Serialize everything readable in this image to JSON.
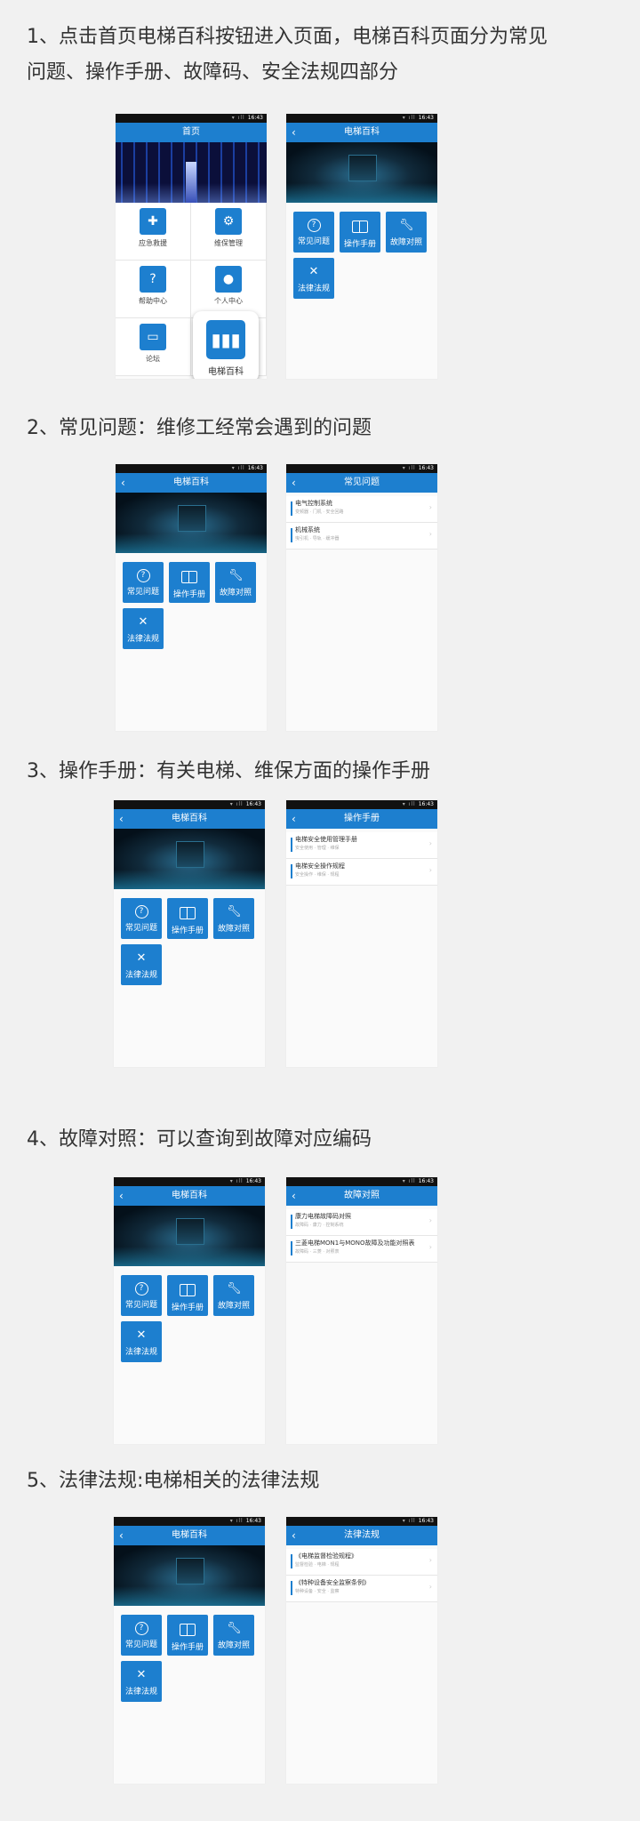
{
  "sections": [
    {
      "title_line1": "1、点击首页电梯百科按钮进入页面，电梯百科页面分为常见",
      "title_line2": "问题、操作手册、故障码、安全法规四部分"
    },
    {
      "title": "2、常见问题：维修工经常会遇到的问题"
    },
    {
      "title": "3、操作手册：有关电梯、维保方面的操作手册"
    },
    {
      "title": "4、故障对照：可以查询到故障对应编码"
    },
    {
      "title": "5、法律法规:电梯相关的法律法规"
    }
  ],
  "status": {
    "time": "16:43",
    "signal": "▾ ıll"
  },
  "home": {
    "title": "首页",
    "cells": [
      "应急救援",
      "维保管理",
      "帮助中心",
      "个人中心",
      "论坛",
      ""
    ],
    "popup_label": "电梯百科"
  },
  "wiki": {
    "title": "电梯百科",
    "back": "‹",
    "tiles": [
      "常见问题",
      "操作手册",
      "故障对照",
      "法律法规"
    ]
  },
  "faq": {
    "title": "常见问题",
    "items": [
      {
        "title": "电气控制系统",
        "sub": "变频器 · 门机 · 安全回路"
      },
      {
        "title": "机械系统",
        "sub": "曳引机 · 导轨 · 缓冲器"
      }
    ]
  },
  "manual": {
    "title": "操作手册",
    "items": [
      {
        "title": "电梯安全使用管理手册",
        "sub": "安全使用 · 管理 · 维保"
      },
      {
        "title": "电梯安全操作规程",
        "sub": "安全操作 · 维保 · 规程"
      }
    ]
  },
  "fault": {
    "title": "故障对照",
    "items": [
      {
        "title": "康力电梯故障码对照",
        "sub": "故障码 · 康力 · 控制系统"
      },
      {
        "title": "三菱电梯MON1与MONO故障及功能对照表",
        "sub": "故障码 · 三菱 · 对照表"
      }
    ]
  },
  "law": {
    "title": "法律法规",
    "items": [
      {
        "title": "《电梯监督检验规程》",
        "sub": "监督检验 · 电梯 · 规程"
      },
      {
        "title": "《特种设备安全监察条例》",
        "sub": "特种设备 · 安全 · 监察"
      }
    ]
  },
  "colors": {
    "accent": "#1d7fcf",
    "background": "#f1f1f1"
  }
}
